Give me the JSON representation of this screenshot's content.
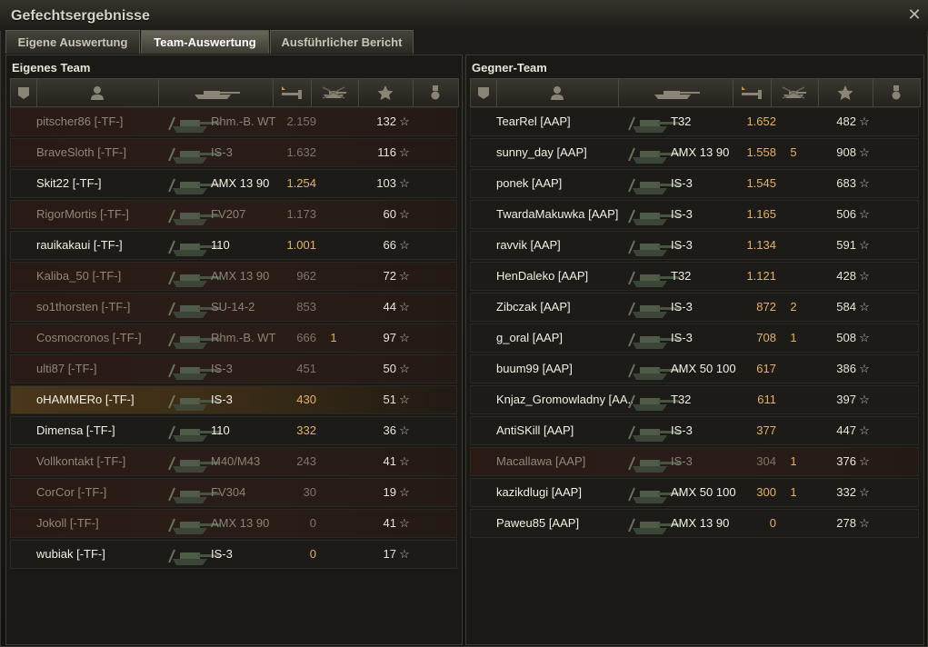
{
  "window": {
    "title": "Gefechtsergebnisse",
    "close": "✕"
  },
  "tabs": [
    {
      "label": "Eigene Auswertung",
      "active": false
    },
    {
      "label": "Team-Auswertung",
      "active": true
    },
    {
      "label": "Ausführlicher Bericht",
      "active": false
    }
  ],
  "columns": [
    "platoon-icon",
    "player-icon",
    "tank-icon",
    "damage-icon",
    "kills-icon",
    "xp-star-icon",
    "medal-icon"
  ],
  "own_team": {
    "title": "Eigenes Team",
    "rows": [
      {
        "player": "pitscher86 [-TF-]",
        "tank": "Rhm.-B. WT",
        "damage": "2.159",
        "kills": "",
        "xp": "132",
        "status": "dead"
      },
      {
        "player": "BraveSloth [-TF-]",
        "tank": "IS-3",
        "damage": "1.632",
        "kills": "",
        "xp": "116",
        "status": "dead"
      },
      {
        "player": "Skit22 [-TF-]",
        "tank": "AMX 13 90",
        "damage": "1.254",
        "kills": "",
        "xp": "103",
        "status": "alive"
      },
      {
        "player": "RigorMortis [-TF-]",
        "tank": "FV207",
        "damage": "1.173",
        "kills": "",
        "xp": "60",
        "status": "dead"
      },
      {
        "player": "rauikakaui [-TF-]",
        "tank": "110",
        "damage": "1.001",
        "kills": "",
        "xp": "66",
        "status": "alive"
      },
      {
        "player": "Kaliba_50 [-TF-]",
        "tank": "AMX 13 90",
        "damage": "962",
        "kills": "",
        "xp": "72",
        "status": "dead"
      },
      {
        "player": "so1thorsten [-TF-]",
        "tank": "SU-14-2",
        "damage": "853",
        "kills": "",
        "xp": "44",
        "status": "dead"
      },
      {
        "player": "Cosmocronos [-TF-]",
        "tank": "Rhm.-B. WT",
        "damage": "666",
        "kills": "1",
        "xp": "97",
        "status": "dead"
      },
      {
        "player": "ulti87 [-TF-]",
        "tank": "IS-3",
        "damage": "451",
        "kills": "",
        "xp": "50",
        "status": "dead"
      },
      {
        "player": "oHAMMERo [-TF-]",
        "tank": "IS-3",
        "damage": "430",
        "kills": "",
        "xp": "51",
        "status": "self"
      },
      {
        "player": "Dimensa [-TF-]",
        "tank": "110",
        "damage": "332",
        "kills": "",
        "xp": "36",
        "status": "alive"
      },
      {
        "player": "Vollkontakt [-TF-]",
        "tank": "M40/M43",
        "damage": "243",
        "kills": "",
        "xp": "41",
        "status": "dead"
      },
      {
        "player": "CorCor [-TF-]",
        "tank": "FV304",
        "damage": "30",
        "kills": "",
        "xp": "19",
        "status": "dead"
      },
      {
        "player": "Jokoll [-TF-]",
        "tank": "AMX 13 90",
        "damage": "0",
        "kills": "",
        "xp": "41",
        "status": "dead"
      },
      {
        "player": "wubiak [-TF-]",
        "tank": "IS-3",
        "damage": "0",
        "kills": "",
        "xp": "17",
        "status": "alive"
      }
    ]
  },
  "enemy_team": {
    "title": "Gegner-Team",
    "rows": [
      {
        "player": "TearRel [AAP]",
        "tank": "T32",
        "damage": "1.652",
        "kills": "",
        "xp": "482",
        "status": "alive"
      },
      {
        "player": "sunny_day [AAP]",
        "tank": "AMX 13 90",
        "damage": "1.558",
        "kills": "5",
        "xp": "908",
        "status": "alive"
      },
      {
        "player": "ponek [AAP]",
        "tank": "IS-3",
        "damage": "1.545",
        "kills": "",
        "xp": "683",
        "status": "alive"
      },
      {
        "player": "TwardaMakuwka [AAP]",
        "tank": "IS-3",
        "damage": "1.165",
        "kills": "",
        "xp": "506",
        "status": "alive"
      },
      {
        "player": "ravvik [AAP]",
        "tank": "IS-3",
        "damage": "1.134",
        "kills": "",
        "xp": "591",
        "status": "alive"
      },
      {
        "player": "HenDaleko [AAP]",
        "tank": "T32",
        "damage": "1.121",
        "kills": "",
        "xp": "428",
        "status": "alive"
      },
      {
        "player": "Zibczak [AAP]",
        "tank": "IS-3",
        "damage": "872",
        "kills": "2",
        "xp": "584",
        "status": "alive"
      },
      {
        "player": "g_oral [AAP]",
        "tank": "IS-3",
        "damage": "708",
        "kills": "1",
        "xp": "508",
        "status": "alive"
      },
      {
        "player": "buum99 [AAP]",
        "tank": "AMX 50 100",
        "damage": "617",
        "kills": "",
        "xp": "386",
        "status": "alive"
      },
      {
        "player": "Knjaz_Gromowladny [AA..",
        "tank": "T32",
        "damage": "611",
        "kills": "",
        "xp": "397",
        "status": "alive"
      },
      {
        "player": "AntiSKill [AAP]",
        "tank": "IS-3",
        "damage": "377",
        "kills": "",
        "xp": "447",
        "status": "alive"
      },
      {
        "player": "Macallawa [AAP]",
        "tank": "IS-3",
        "damage": "304",
        "kills": "1",
        "xp": "376",
        "status": "dead"
      },
      {
        "player": "kazikdlugi [AAP]",
        "tank": "AMX 50 100",
        "damage": "300",
        "kills": "1",
        "xp": "332",
        "status": "alive"
      },
      {
        "player": "Paweu85 [AAP]",
        "tank": "AMX 13 90",
        "damage": "0",
        "kills": "",
        "xp": "278",
        "status": "alive"
      }
    ]
  },
  "colors": {
    "damage": "#e3b35e",
    "dead_row": "#2a1a16",
    "self_row": "#4a361a",
    "text": "#f3efe4"
  },
  "star": "☆"
}
